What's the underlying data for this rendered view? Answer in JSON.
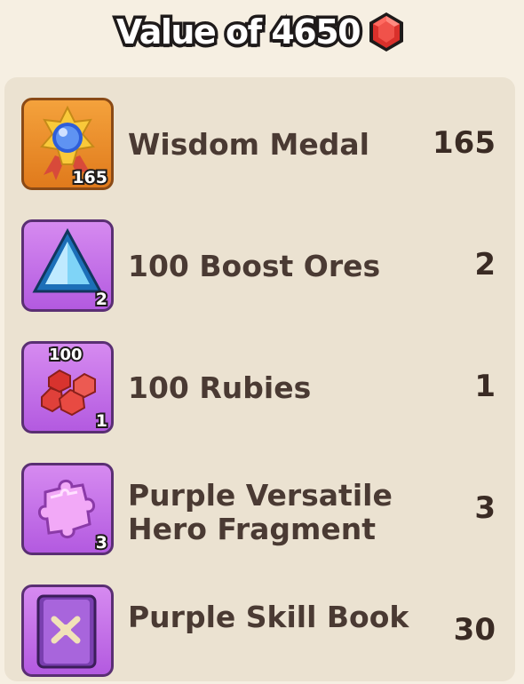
{
  "header": {
    "title": "Value of 4650",
    "currency_icon": "ruby-gem-icon",
    "accent": "#d9302b"
  },
  "items": [
    {
      "name": "Wisdom Medal",
      "count": "165",
      "badge": "165",
      "icon": "wisdom-medal-icon",
      "tile_color": "#f0902c"
    },
    {
      "name": "100 Boost Ores",
      "count": "2",
      "badge": "2",
      "icon": "boost-ore-icon",
      "tile_color": "#c874ec"
    },
    {
      "name": "100 Rubies",
      "count": "1",
      "badge": "1",
      "top_badge": "100",
      "icon": "rubies-pile-icon",
      "tile_color": "#c874ec"
    },
    {
      "name": "Purple Versatile Hero Fragment",
      "count": "3",
      "badge": "3",
      "icon": "puzzle-fragment-icon",
      "tile_color": "#c874ec"
    },
    {
      "name": "Purple Skill Book",
      "count": "30",
      "icon": "skill-book-icon",
      "tile_color": "#c874ec"
    }
  ]
}
